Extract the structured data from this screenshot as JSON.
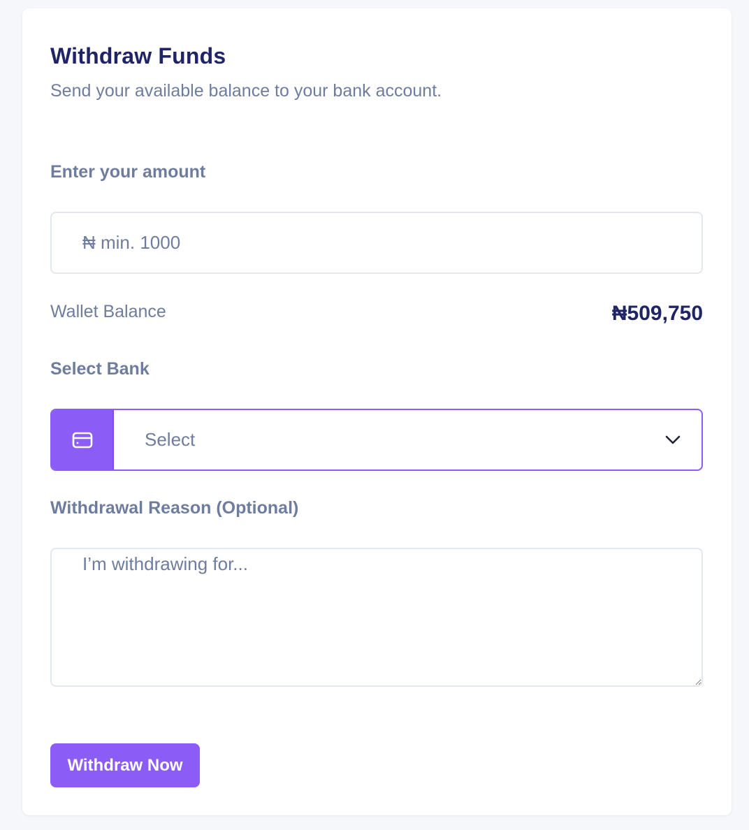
{
  "header": {
    "title": "Withdraw Funds",
    "subtitle": "Send your available balance to your bank account."
  },
  "amount": {
    "label": "Enter your amount",
    "placeholder": "₦ min. 1000",
    "value": ""
  },
  "wallet": {
    "label": "Wallet Balance",
    "balance": "₦509,750"
  },
  "bank": {
    "label": "Select Bank",
    "selected": "Select",
    "icon": "card-icon"
  },
  "reason": {
    "label": "Withdrawal Reason (Optional)",
    "placeholder": "I’m withdrawing for..."
  },
  "actions": {
    "submit_label": "Withdraw Now"
  },
  "colors": {
    "accent": "#8b5cf6",
    "heading": "#1f2466",
    "muted": "#6e7d9e",
    "border": "#e4e7ee",
    "background": "#f6f7fb"
  }
}
